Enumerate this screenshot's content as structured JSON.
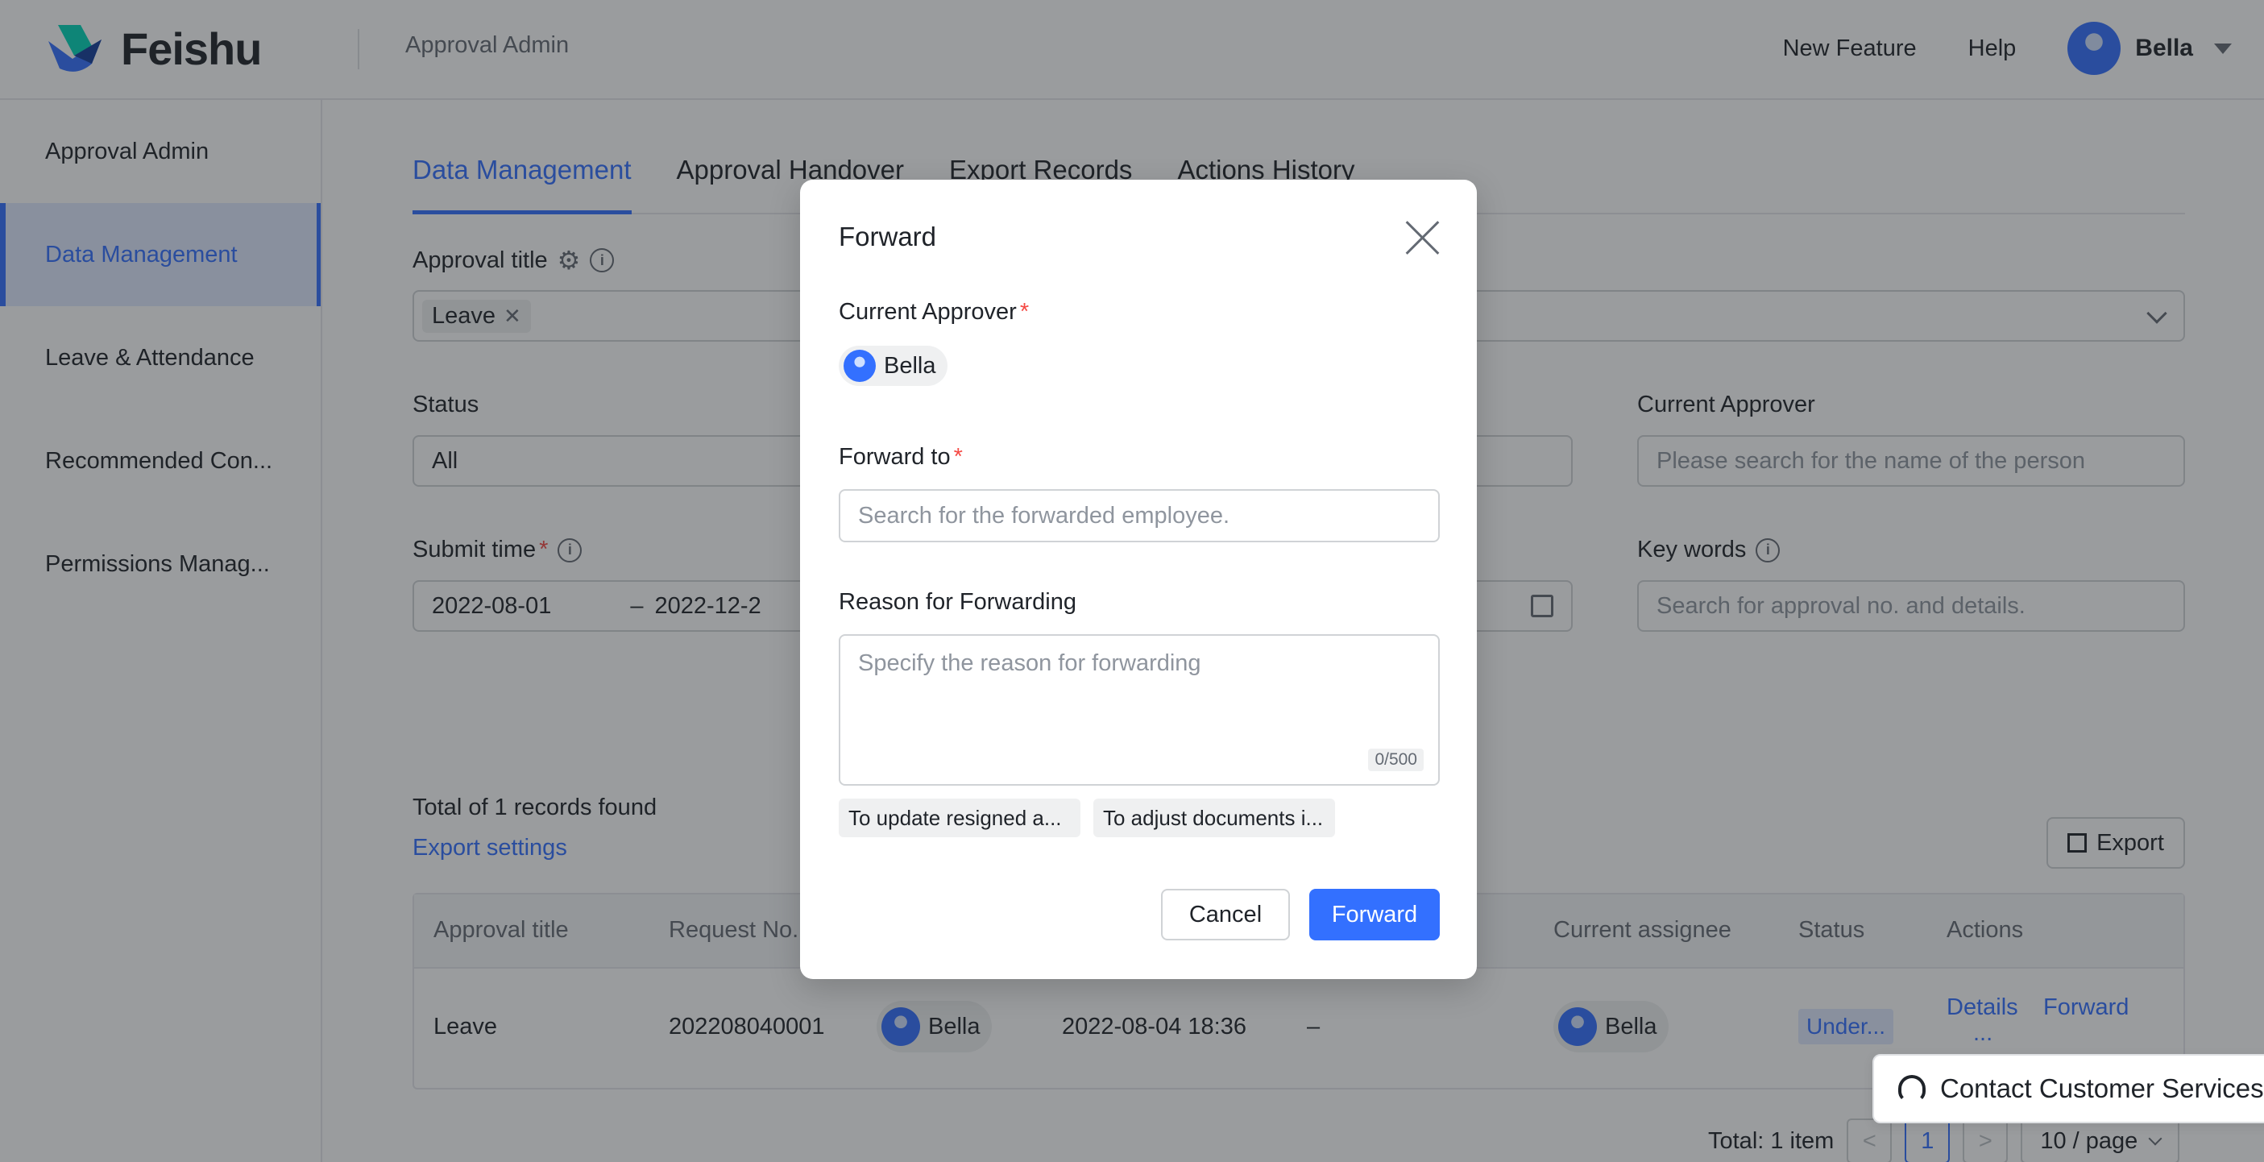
{
  "header": {
    "logo_text": "Feishu",
    "app_name": "Approval Admin",
    "links": [
      "New Feature",
      "Help"
    ],
    "user_name": "Bella"
  },
  "sidebar": {
    "items": [
      {
        "label": "Approval Admin"
      },
      {
        "label": "Data Management"
      },
      {
        "label": "Leave & Attendance"
      },
      {
        "label": "Recommended Con..."
      },
      {
        "label": "Permissions Manag..."
      }
    ],
    "active_index": 1
  },
  "tabs": [
    "Data Management",
    "Approval Handover",
    "Export Records",
    "Actions History"
  ],
  "filters": {
    "approval_title_label": "Approval title",
    "approval_title_chip": "Leave",
    "status_label": "Status",
    "status_value": "All",
    "current_approver_label": "Current Approver",
    "current_approver_placeholder": "Please search for the name of the person",
    "submit_time_label": "Submit time",
    "submit_time_start": "2022-08-01",
    "submit_time_sep": "–",
    "submit_time_end": "2022-12-2",
    "keywords_label": "Key words",
    "keywords_placeholder": "Search for approval no. and details."
  },
  "results": {
    "summary": "Total of 1 records found",
    "export_settings": "Export settings",
    "export_button": "Export"
  },
  "table": {
    "headers": [
      "Approval title",
      "Request No.",
      "Current assignee",
      "Status",
      "Actions"
    ],
    "rows": [
      {
        "title": "Leave",
        "request_no": "202208040001",
        "submitter": "Bella",
        "submit_time": "2022-08-04 18:36",
        "dash": "–",
        "assignee": "Bella",
        "status": "Under...",
        "action_details": "Details",
        "action_forward": "Forward",
        "action_more": "..."
      }
    ]
  },
  "pagination": {
    "total": "Total: 1 item",
    "prev": "<",
    "current": "1",
    "next": ">",
    "page_size": "10 / page"
  },
  "support": {
    "label": "Contact Customer Services"
  },
  "modal": {
    "title": "Forward",
    "current_approver_label": "Current Approver",
    "current_approver": "Bella",
    "forward_to_label": "Forward to",
    "forward_to_placeholder": "Search for the forwarded employee.",
    "reason_label": "Reason for Forwarding",
    "reason_placeholder": "Specify the reason for forwarding",
    "char_count": "0/500",
    "quick_reasons": [
      "To update resigned a...",
      "To adjust documents i..."
    ],
    "cancel": "Cancel",
    "forward": "Forward",
    "required_mark": "*"
  },
  "colors": {
    "accent": "#3370ff",
    "required": "#f54a45",
    "mask": "rgba(31,35,41,0.45)"
  }
}
